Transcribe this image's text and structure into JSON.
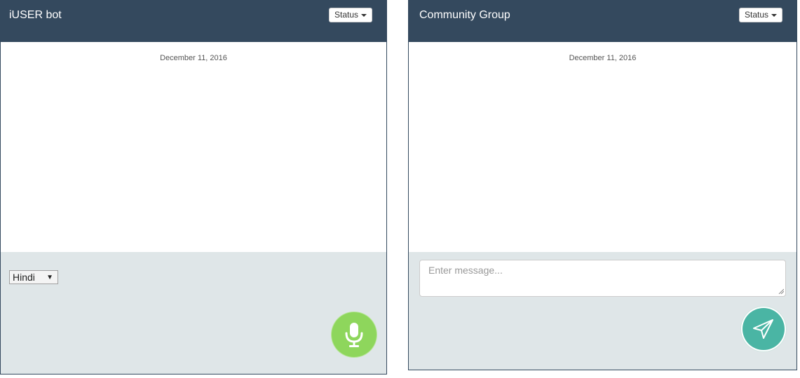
{
  "chats": [
    {
      "title": "iUSER bot",
      "status_label": "Status",
      "date": "December 11, 2016",
      "language": "Hindi",
      "icon": "microphone-icon",
      "accent_color": "#8ed65c"
    },
    {
      "title": "Community Group",
      "status_label": "Status",
      "date": "December 11, 2016",
      "message_placeholder": "Enter message...",
      "icon": "send-icon",
      "accent_color": "#4ab5a4"
    }
  ],
  "theme": {
    "header_color": "#34495e",
    "footer_color": "#dfe6e8"
  }
}
